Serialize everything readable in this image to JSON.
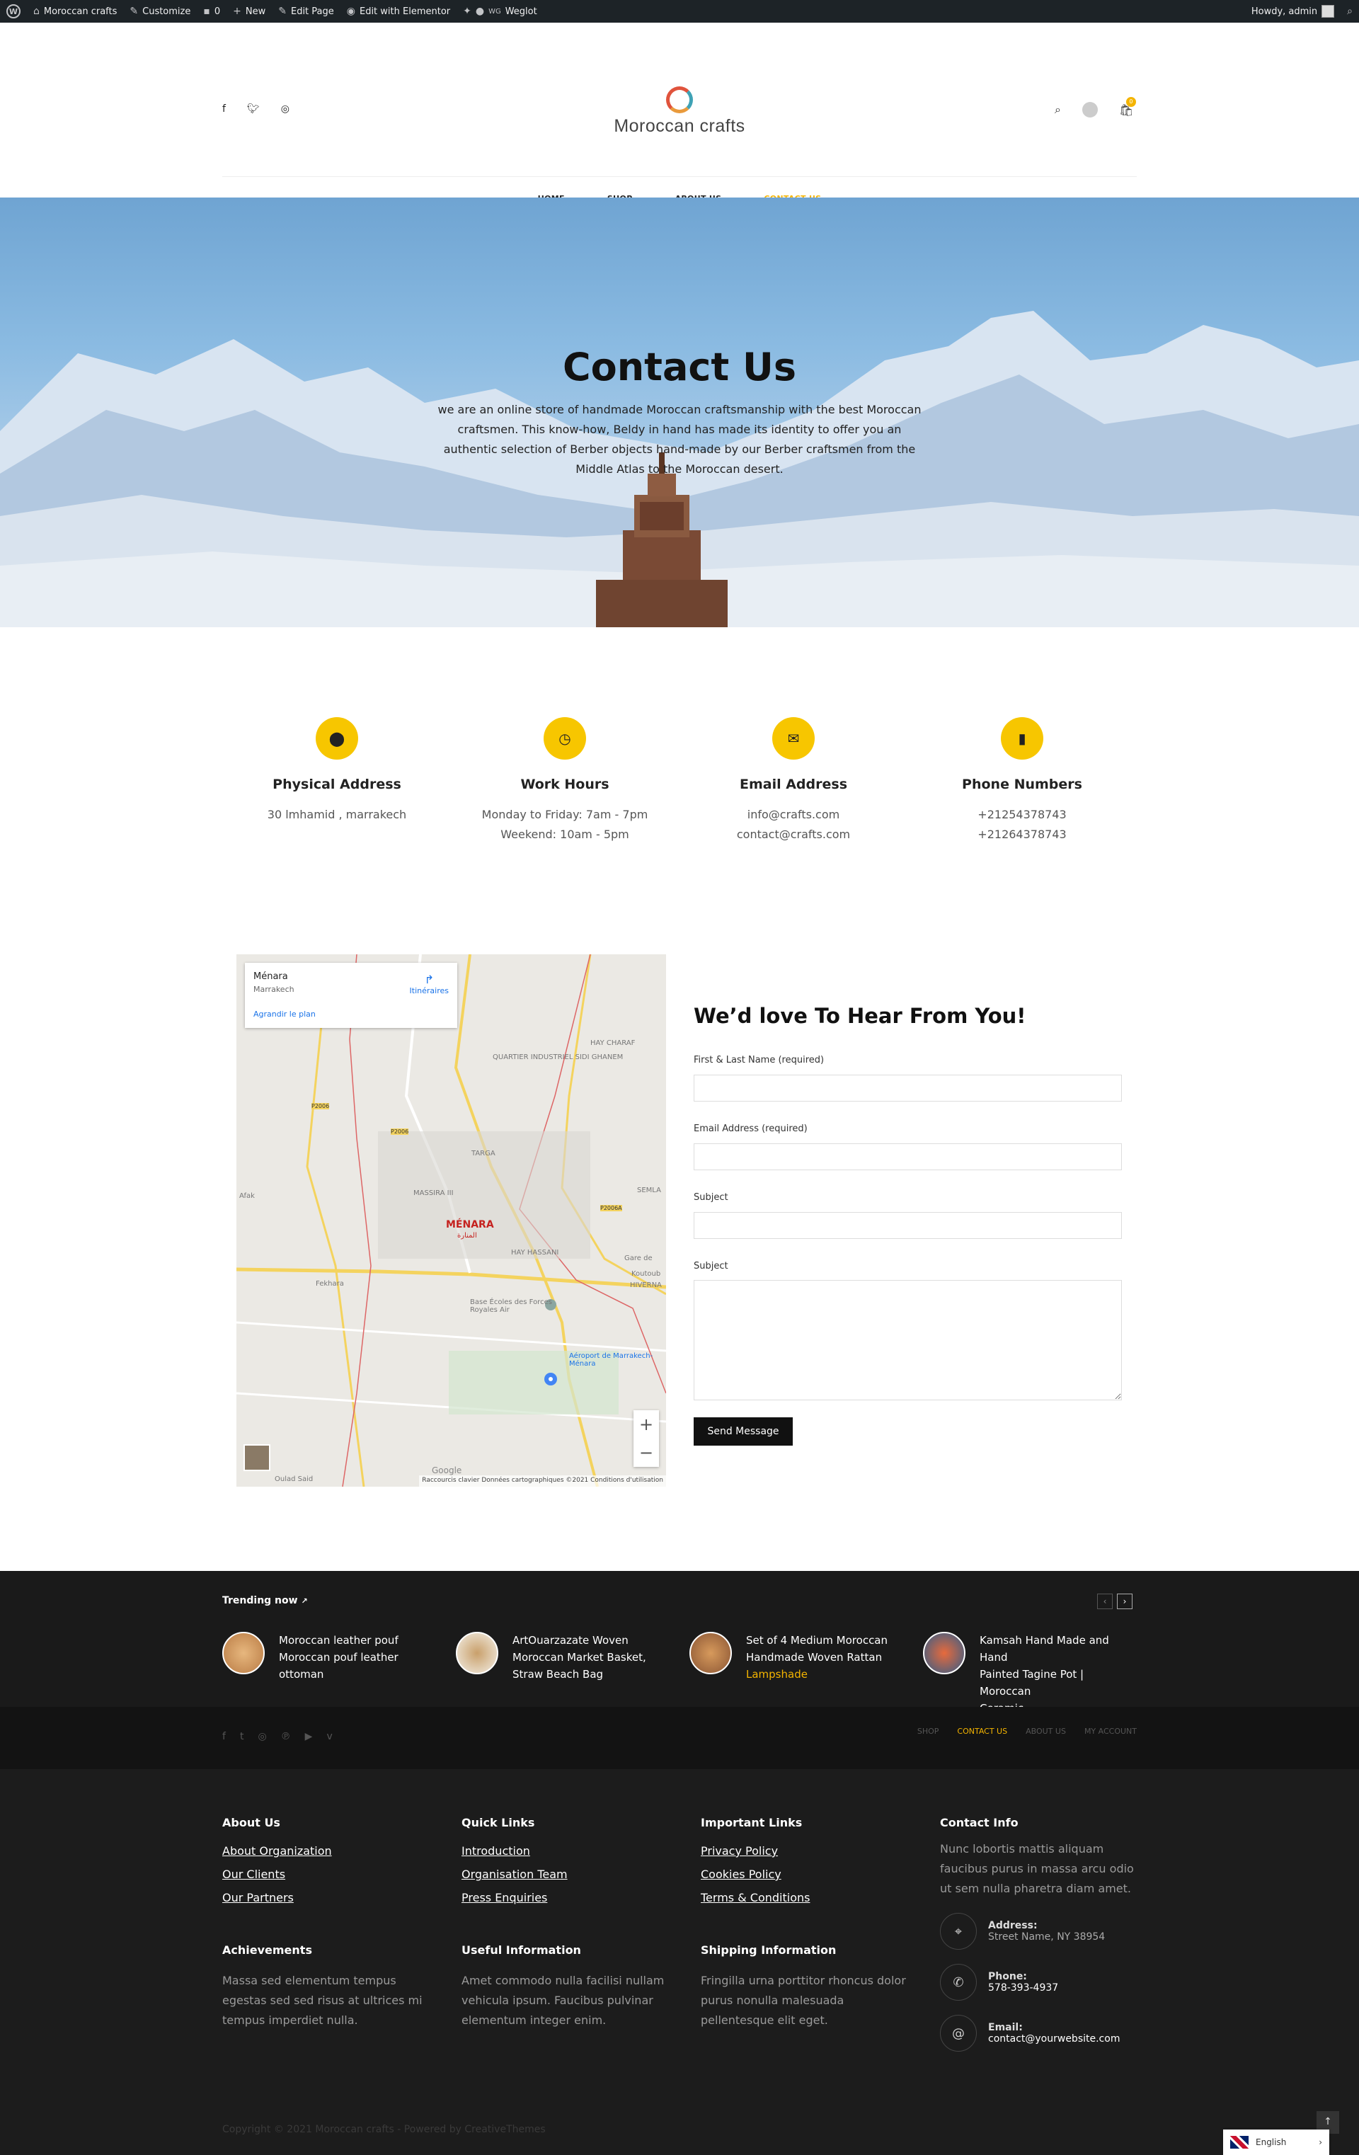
{
  "admin_bar": {
    "site_name": "Moroccan crafts",
    "customize": "Customize",
    "comments_count": "0",
    "new_label": "New",
    "edit_page": "Edit Page",
    "edit_elementor": "Edit with Elementor",
    "weglot": "Weglot",
    "howdy": "Howdy, admin"
  },
  "header": {
    "logo_text": "Moroccan crafts",
    "cart_count": "0",
    "social_icons": [
      "facebook-icon",
      "twitter-icon",
      "instagram-icon"
    ],
    "nav": [
      {
        "label": "HOME",
        "active": false
      },
      {
        "label": "SHOP",
        "active": false
      },
      {
        "label": "ABOUT US",
        "active": false
      },
      {
        "label": "CONTACT US",
        "active": true
      }
    ],
    "accent_color": "#f4b400"
  },
  "hero": {
    "title": "Contact Us",
    "text": "we are an online store of handmade Moroccan craftsmanship with the best Moroccan craftsmen. This know-how, Beldy in hand has made its identity to offer you an authentic selection of Berber objects hand-made by our Berber craftsmen from the Middle Atlas to the Moroccan desert."
  },
  "info": [
    {
      "icon": "location-pin-icon",
      "title": "Physical Address",
      "lines": [
        "30 lmhamid , marrakech"
      ]
    },
    {
      "icon": "clock-icon",
      "title": "Work Hours",
      "lines": [
        "Monday to Friday: 7am - 7pm",
        "Weekend: 10am - 5pm"
      ]
    },
    {
      "icon": "envelope-icon",
      "title": "Email Address",
      "lines": [
        "info@crafts.com",
        "contact@crafts.com"
      ]
    },
    {
      "icon": "phone-icon",
      "title": "Phone Numbers",
      "lines": [
        "+21254378743",
        "+21264378743"
      ]
    }
  ],
  "map": {
    "place": "Ménara",
    "city": "Marrakech",
    "directions": "Itinéraires",
    "enlarge": "Agrandir le plan",
    "google": "Google",
    "footer": "Raccourcis clavier   Données cartographiques ©2021   Conditions d'utilisation",
    "labels": [
      "QUARTIER INDUSTRIEL SIDI GHANEM",
      "HAY CHARAF",
      "TARGA",
      "MASSIRA III",
      "MÉNARA",
      "المنارة",
      "HAY HASSANI",
      "Fekhara",
      "Base Écoles des Forces Royales Air",
      "Aéroport de Marrakech-Ménara",
      "Afak",
      "Gare de",
      "Koutoub",
      "HIVERNA",
      "SEMLA",
      "Oulad Said",
      "P2006",
      "P2006",
      "P2006A"
    ]
  },
  "form": {
    "title": "We’d love To Hear From You!",
    "fields": [
      {
        "label": "First & Last Name (required)",
        "value": ""
      },
      {
        "label": "Email Address (required)",
        "value": ""
      },
      {
        "label": "Subject",
        "value": ""
      }
    ],
    "message_label": "Subject",
    "button": "Send Message"
  },
  "trending": {
    "title": "Trending now",
    "items": [
      {
        "lines": [
          "Moroccan leather pouf",
          "Moroccan pouf leather",
          "ottoman"
        ],
        "accent": ""
      },
      {
        "lines": [
          "ArtOuarzazate Woven",
          "Moroccan Market Basket,",
          "Straw Beach Bag"
        ],
        "accent": ""
      },
      {
        "lines": [
          "Set of 4 Medium Moroccan",
          "Handmade Woven Rattan"
        ],
        "accent": "Lampshade"
      },
      {
        "lines": [
          "Kamsah Hand Made and Hand",
          "Painted Tagine Pot | Moroccan",
          "Ceramic"
        ],
        "accent": ""
      }
    ]
  },
  "footer_nav": [
    {
      "label": "SHOP",
      "active": false
    },
    {
      "label": "CONTACT US",
      "active": true
    },
    {
      "label": "ABOUT US",
      "active": false
    },
    {
      "label": "MY ACCOUNT",
      "active": false
    }
  ],
  "footer": {
    "about": {
      "title": "About Us",
      "links": [
        "About Organization",
        "Our Clients",
        "Our Partners"
      ]
    },
    "quick": {
      "title": "Quick Links",
      "links": [
        "Introduction",
        "Organisation Team",
        "Press Enquiries"
      ]
    },
    "important": {
      "title": "Important Links",
      "links": [
        "Privacy Policy",
        "Cookies Policy",
        "Terms & Conditions"
      ]
    },
    "contact": {
      "title": "Contact Info",
      "text": "Nunc lobortis mattis aliquam faucibus purus in massa arcu odio ut sem nulla pharetra diam amet.",
      "address_label": "Address:",
      "address": "Street Name, NY 38954",
      "phone_label": "Phone:",
      "phone": "578-393-4937",
      "email_label": "Email:",
      "email": "contact@yourwebsite.com"
    },
    "achievements": {
      "title": "Achievements",
      "text": "Massa sed elementum tempus egestas sed sed risus at ultrices mi tempus imperdiet nulla."
    },
    "useful": {
      "title": "Useful Information",
      "text": "Amet commodo nulla facilisi nullam vehicula ipsum. Faucibus pulvinar elementum integer enim."
    },
    "shipping": {
      "title": "Shipping Information",
      "text": "Fringilla urna porttitor rhoncus dolor purus nonulla malesuada pellentesque elit eget."
    },
    "copyright": "Copyright © 2021 Moroccan crafts - Powered by CreativeThemes",
    "language": "English"
  }
}
